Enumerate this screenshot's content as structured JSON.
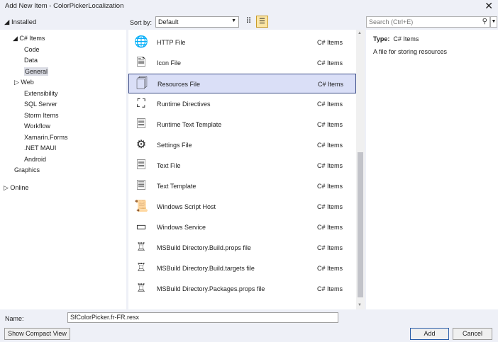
{
  "window": {
    "title": "Add New Item - ColorPickerLocalization",
    "close_icon": "close-icon"
  },
  "toolbar": {
    "installed": "◢ Installed",
    "sort_label": "Sort by:",
    "sort_value": "Default",
    "search_placeholder": "Search (Ctrl+E)"
  },
  "tree": [
    {
      "label": "◢ C# Items",
      "indent": 18
    },
    {
      "label": "Code",
      "indent": 34
    },
    {
      "label": "Data",
      "indent": 34
    },
    {
      "label": "General",
      "indent": 34,
      "selected": true
    },
    {
      "label": "▷ Web",
      "indent": 20
    },
    {
      "label": "Extensibility",
      "indent": 34
    },
    {
      "label": "SQL Server",
      "indent": 34
    },
    {
      "label": "Storm Items",
      "indent": 34
    },
    {
      "label": "Workflow",
      "indent": 34
    },
    {
      "label": "Xamarin.Forms",
      "indent": 34
    },
    {
      "label": ".NET MAUI",
      "indent": 34
    },
    {
      "label": "Android",
      "indent": 34
    },
    {
      "label": "Graphics",
      "indent": 20
    }
  ],
  "online": "▷ Online",
  "items": [
    {
      "name": "HTTP File",
      "category": "C# Items",
      "icon": "globe-upload-icon",
      "glyph": "🌐"
    },
    {
      "name": "Icon File",
      "category": "C# Items",
      "icon": "icon-file-icon",
      "glyph": "🗎"
    },
    {
      "name": "Resources File",
      "category": "C# Items",
      "icon": "resources-file-icon",
      "glyph": "🗍",
      "selected": true
    },
    {
      "name": "Runtime Directives",
      "category": "C# Items",
      "icon": "runtime-directives-icon",
      "glyph": "⛶"
    },
    {
      "name": "Runtime Text Template",
      "category": "C# Items",
      "icon": "text-template-icon",
      "glyph": "🗏"
    },
    {
      "name": "Settings File",
      "category": "C# Items",
      "icon": "gear-icon",
      "glyph": "⚙"
    },
    {
      "name": "Text File",
      "category": "C# Items",
      "icon": "text-file-icon",
      "glyph": "🗏"
    },
    {
      "name": "Text Template",
      "category": "C# Items",
      "icon": "text-template-icon",
      "glyph": "🗏"
    },
    {
      "name": "Windows Script Host",
      "category": "C# Items",
      "icon": "script-icon",
      "glyph": "📜"
    },
    {
      "name": "Windows Service",
      "category": "C# Items",
      "icon": "windows-service-icon",
      "glyph": "▭"
    },
    {
      "name": "MSBuild Directory.Build.props file",
      "category": "C# Items",
      "icon": "msbuild-icon",
      "glyph": "♖"
    },
    {
      "name": "MSBuild Directory.Build.targets file",
      "category": "C# Items",
      "icon": "msbuild-icon",
      "glyph": "♖"
    },
    {
      "name": "MSBuild Directory.Packages.props file",
      "category": "C# Items",
      "icon": "msbuild-icon",
      "glyph": "♖"
    }
  ],
  "details": {
    "type_label": "Type:",
    "type_value": "C# Items",
    "description": "A file for storing resources"
  },
  "footer": {
    "name_label": "Name:",
    "name_value": "SfColorPicker.fr-FR.resx",
    "compact": "Show Compact View",
    "add": "Add",
    "cancel": "Cancel"
  }
}
